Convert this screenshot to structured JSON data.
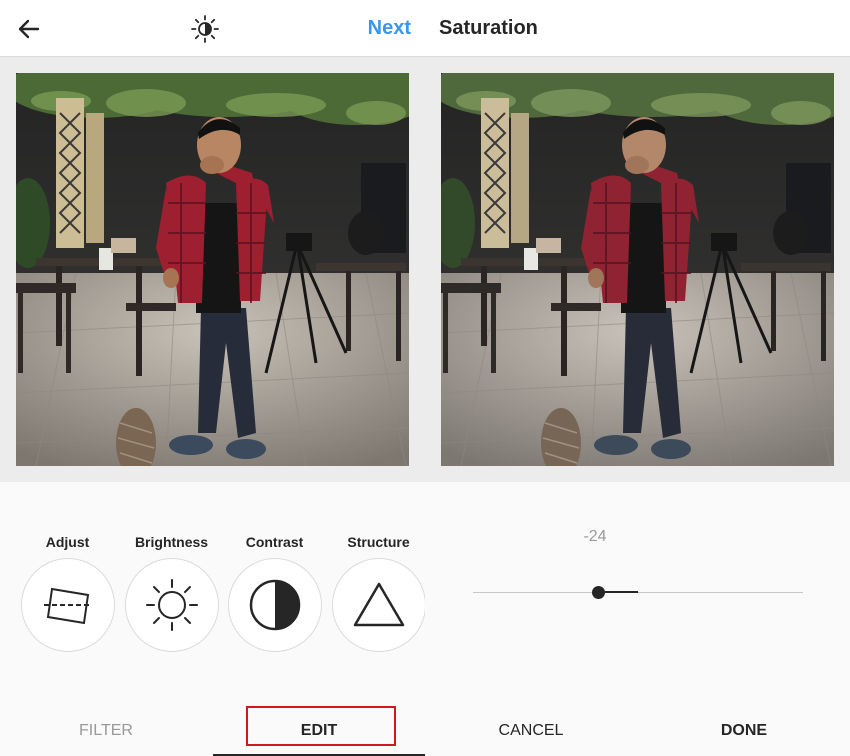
{
  "left_panel": {
    "header": {
      "next_label": "Next",
      "back_icon": "arrow-left-icon",
      "lux_icon": "lux-sun-icon"
    },
    "tools": [
      {
        "label": "Adjust",
        "icon": "adjust-icon"
      },
      {
        "label": "Brightness",
        "icon": "brightness-sun-icon"
      },
      {
        "label": "Contrast",
        "icon": "contrast-icon"
      },
      {
        "label": "Structure",
        "icon": "triangle-icon"
      }
    ],
    "tabs": {
      "filter": "FILTER",
      "edit": "EDIT"
    }
  },
  "right_panel": {
    "title": "Saturation",
    "slider": {
      "value_label": "-24",
      "value": -24,
      "min": -100,
      "max": 100
    },
    "cancel": "CANCEL",
    "done": "DONE"
  },
  "colors": {
    "accent": "#3897f0",
    "highlight": "#d0191f",
    "shirt": "#9e1f30",
    "jeans": "#262c3a"
  }
}
